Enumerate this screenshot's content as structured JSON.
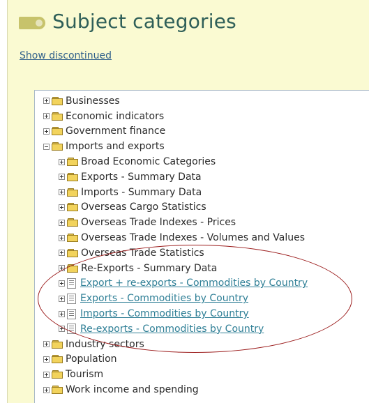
{
  "header": {
    "title": "Subject categories"
  },
  "show_discontinued": "Show discontinued",
  "tree": {
    "businesses": "Businesses",
    "economic_indicators": "Economic indicators",
    "government_finance": "Government finance",
    "imports_exports": {
      "label": "Imports and exports",
      "children": {
        "broad_economic": "Broad Economic Categories",
        "exports_summary": "Exports - Summary Data",
        "imports_summary": "Imports - Summary Data",
        "overseas_cargo": "Overseas Cargo Statistics",
        "trade_indexes_prices": "Overseas Trade Indexes - Prices",
        "trade_indexes_volumes": "Overseas Trade Indexes - Volumes and Values",
        "overseas_trade_stats": "Overseas Trade Statistics",
        "reexports_summary": "Re-Exports - Summary Data",
        "export_reexports_commodities": "Export + re-exports - Commodities by Country",
        "exports_commodities": "Exports - Commodities by Country",
        "imports_commodities": "Imports - Commodities by Country",
        "reexports_commodities": "Re-exports - Commodities by Country"
      }
    },
    "industry_sectors": "Industry sectors",
    "population": "Population",
    "tourism": "Tourism",
    "work_income": "Work income and spending"
  },
  "colors": {
    "panel_bg": "#fafad2",
    "title": "#2f5f58",
    "link": "#2f7f96",
    "annotation": "#9b1b1b"
  }
}
